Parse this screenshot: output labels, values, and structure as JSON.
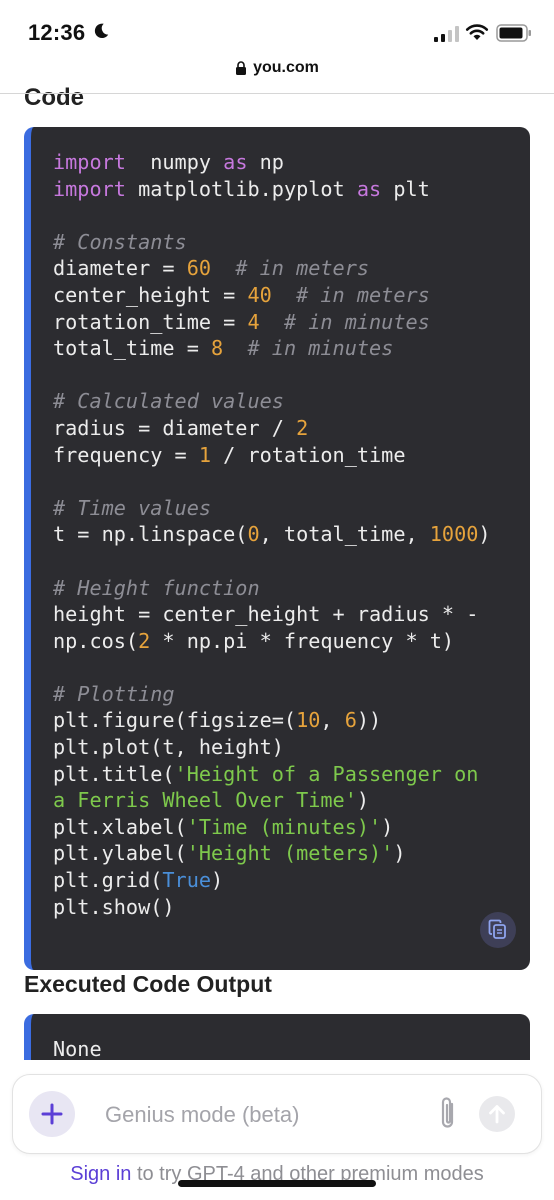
{
  "status": {
    "time": "12:36"
  },
  "browser": {
    "url": "you.com"
  },
  "content": {
    "code_heading": "Code",
    "code_lines": [
      [
        [
          "kw",
          "import"
        ],
        [
          "",
          "  numpy "
        ],
        [
          "kw",
          "as"
        ],
        [
          "",
          " np"
        ]
      ],
      [
        [
          "kw",
          "import"
        ],
        [
          "",
          " matplotlib.pyplot "
        ],
        [
          "kw",
          "as"
        ],
        [
          "",
          " plt"
        ]
      ],
      [],
      [
        [
          "cmt",
          "# Constants"
        ]
      ],
      [
        [
          "",
          "diameter = "
        ],
        [
          "num",
          "60"
        ],
        [
          "",
          "  "
        ],
        [
          "cmt",
          "# in meters"
        ]
      ],
      [
        [
          "",
          "center_height = "
        ],
        [
          "num",
          "40"
        ],
        [
          "",
          "  "
        ],
        [
          "cmt",
          "# in meters"
        ]
      ],
      [
        [
          "",
          "rotation_time = "
        ],
        [
          "num",
          "4"
        ],
        [
          "",
          "  "
        ],
        [
          "cmt",
          "# in minutes"
        ]
      ],
      [
        [
          "",
          "total_time = "
        ],
        [
          "num",
          "8"
        ],
        [
          "",
          "  "
        ],
        [
          "cmt",
          "# in minutes"
        ]
      ],
      [],
      [
        [
          "cmt",
          "# Calculated values"
        ]
      ],
      [
        [
          "",
          "radius = diameter / "
        ],
        [
          "num",
          "2"
        ]
      ],
      [
        [
          "",
          "frequency = "
        ],
        [
          "num",
          "1"
        ],
        [
          "",
          " / rotation_time"
        ]
      ],
      [],
      [
        [
          "cmt",
          "# Time values"
        ]
      ],
      [
        [
          "",
          "t = np.linspace("
        ],
        [
          "num",
          "0"
        ],
        [
          "",
          ", total_time, "
        ],
        [
          "num",
          "1000"
        ],
        [
          "",
          ")"
        ]
      ],
      [],
      [
        [
          "cmt",
          "# Height function"
        ]
      ],
      [
        [
          "",
          "height = center_height + radius * -"
        ]
      ],
      [
        [
          "",
          "np.cos("
        ],
        [
          "num",
          "2"
        ],
        [
          "",
          " * np.pi * frequency * t)"
        ]
      ],
      [],
      [
        [
          "cmt",
          "# Plotting"
        ]
      ],
      [
        [
          "",
          "plt.figure(figsize=("
        ],
        [
          "num",
          "10"
        ],
        [
          "",
          ", "
        ],
        [
          "num",
          "6"
        ],
        [
          "",
          "))"
        ]
      ],
      [
        [
          "",
          "plt.plot(t, height)"
        ]
      ],
      [
        [
          "",
          "plt.title("
        ],
        [
          "str",
          "'Height of a Passenger on"
        ]
      ],
      [
        [
          "str",
          "a Ferris Wheel Over Time'"
        ],
        [
          "",
          ")"
        ]
      ],
      [
        [
          "",
          "plt.xlabel("
        ],
        [
          "str",
          "'Time (minutes)'"
        ],
        [
          "",
          ")"
        ]
      ],
      [
        [
          "",
          "plt.ylabel("
        ],
        [
          "str",
          "'Height (meters)'"
        ],
        [
          "",
          ")"
        ]
      ],
      [
        [
          "",
          "plt.grid("
        ],
        [
          "bool",
          "True"
        ],
        [
          "",
          ")"
        ]
      ],
      [
        [
          "",
          "plt.show()"
        ]
      ]
    ],
    "output_heading": "Executed Code Output",
    "output_text": "None"
  },
  "composer": {
    "placeholder": "Genius mode (beta)",
    "signin_link": "Sign in",
    "signin_rest": " to try GPT-4 and other premium modes"
  },
  "colors": {
    "accent": "#3b6ce0",
    "link": "#5b3fd6",
    "code_bg": "#2c2c30"
  }
}
